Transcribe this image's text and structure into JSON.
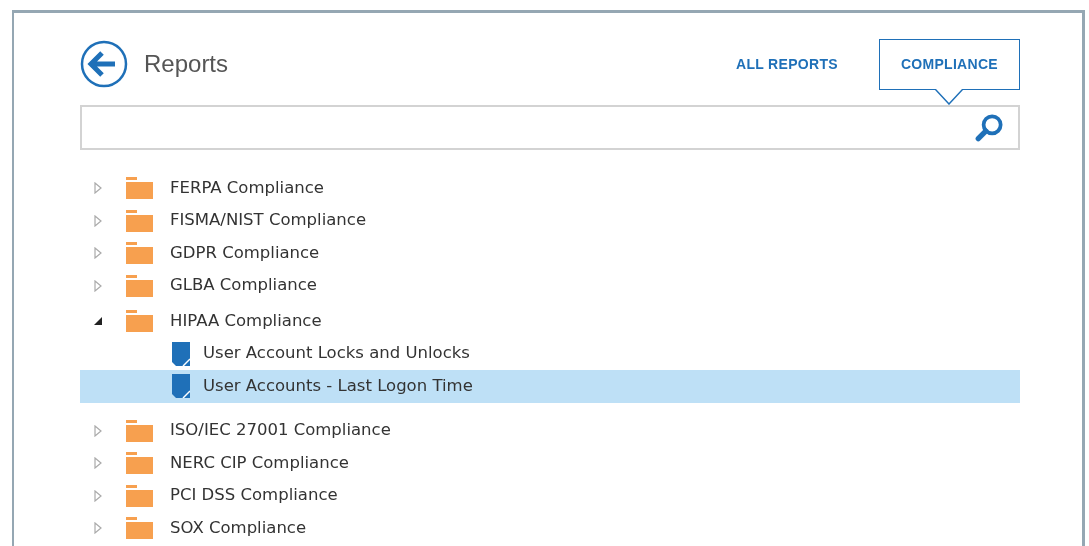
{
  "header": {
    "title": "Reports"
  },
  "tabs": [
    {
      "label": "ALL REPORTS",
      "selected": false
    },
    {
      "label": "COMPLIANCE",
      "selected": true
    }
  ],
  "tree": [
    {
      "label": "FERPA Compliance",
      "kind": "folder",
      "expanded": false,
      "selected": false
    },
    {
      "label": "FISMA/NIST Compliance",
      "kind": "folder",
      "expanded": false,
      "selected": false
    },
    {
      "label": "GDPR Compliance",
      "kind": "folder",
      "expanded": false,
      "selected": false
    },
    {
      "label": "GLBA Compliance",
      "kind": "folder",
      "expanded": false,
      "selected": false
    },
    {
      "label": "HIPAA Compliance",
      "kind": "folder",
      "expanded": true,
      "selected": false,
      "children": [
        {
          "label": "User Account Locks and Unlocks",
          "kind": "report",
          "selected": false
        },
        {
          "label": "User Accounts - Last Logon Time",
          "kind": "report",
          "selected": true
        }
      ]
    },
    {
      "label": "ISO/IEC 27001 Compliance",
      "kind": "folder",
      "expanded": false,
      "selected": false
    },
    {
      "label": "NERC CIP Compliance",
      "kind": "folder",
      "expanded": false,
      "selected": false
    },
    {
      "label": "PCI DSS Compliance",
      "kind": "folder",
      "expanded": false,
      "selected": false
    },
    {
      "label": "SOX Compliance",
      "kind": "folder",
      "expanded": false,
      "selected": false
    }
  ]
}
